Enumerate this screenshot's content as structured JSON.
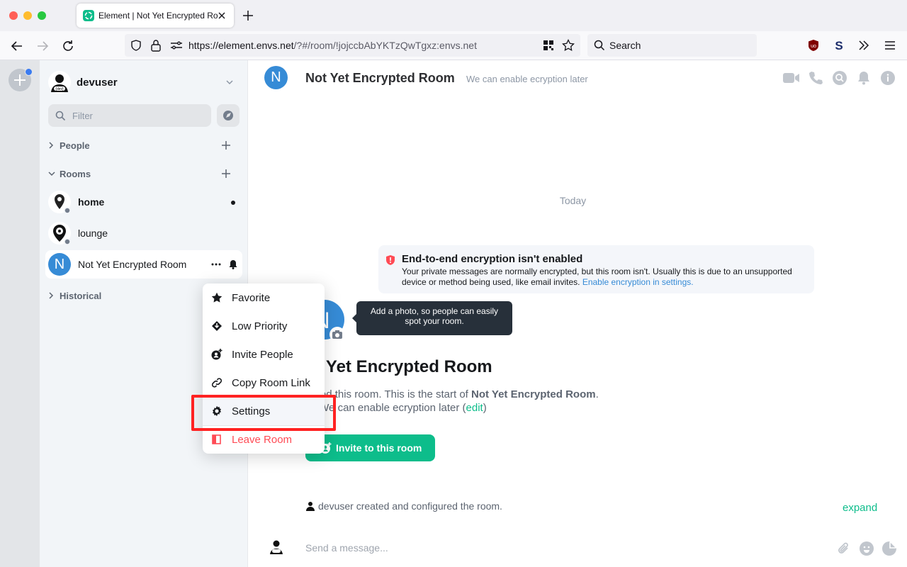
{
  "browser": {
    "tab_title": "Element | Not Yet Encrypted Room",
    "url_host": "https://element.envs.net",
    "url_path": "/?#/room/!jojccbAbYKTzQwTgxz:envs.net",
    "search_placeholder": "Search",
    "colors": {
      "close": "#ff5f57",
      "minimize": "#febc2e",
      "zoom": "#28c840"
    }
  },
  "user": {
    "name": "devuser",
    "avatar_icon": "dev-avatar-icon"
  },
  "sidebar": {
    "filter_placeholder": "Filter",
    "sections": {
      "people": "People",
      "rooms": "Rooms",
      "historical": "Historical"
    },
    "rooms": [
      {
        "name": "home",
        "unread": true
      },
      {
        "name": "lounge",
        "unread": false
      },
      {
        "name": "Not Yet Encrypted Room",
        "avatar_letter": "N",
        "selected": true
      }
    ]
  },
  "context_menu": {
    "items": [
      {
        "label": "Favorite",
        "icon": "star-icon"
      },
      {
        "label": "Low Priority",
        "icon": "low-priority-icon"
      },
      {
        "label": "Invite People",
        "icon": "invite-icon"
      },
      {
        "label": "Copy Room Link",
        "icon": "link-icon"
      },
      {
        "label": "Settings",
        "icon": "gear-icon",
        "highlighted": true
      },
      {
        "label": "Leave Room",
        "icon": "leave-icon",
        "danger": true
      }
    ]
  },
  "room": {
    "avatar_letter": "N",
    "title": "Not Yet Encrypted Room",
    "topic": "We can enable ecryption later",
    "date_separator": "Today",
    "e2e_notice": {
      "title": "End-to-end encryption isn't enabled",
      "body": "Your private messages are normally encrypted, but this room isn't. Usually this is due to an unsupported device or method being used, like email invites.",
      "link": "Enable encryption in settings."
    },
    "tooltip": "Add a photo, so people can easily spot your room.",
    "heading": "ot Yet Encrypted Room",
    "created_prefix": "eated this room. This is the start of",
    "created_room": "Not Yet Encrypted Room",
    "created_suffix": ".",
    "topic_prefix": "ic: We can enable ecryption later (",
    "topic_edit": "edit",
    "topic_suffix": ")",
    "invite_button": "Invite to this room",
    "configured_text": "devuser created and configured the room.",
    "expand": "expand",
    "composer_placeholder": "Send a message..."
  },
  "colors": {
    "accent": "#0dbd8b",
    "avatar": "#368bd6",
    "danger": "#ff4b55",
    "highlight": "#ff2222"
  }
}
